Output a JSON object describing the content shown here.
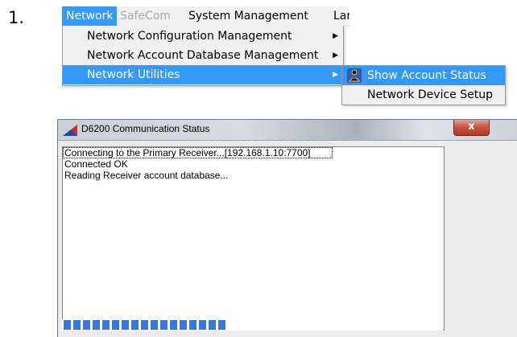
{
  "step": {
    "number": "1."
  },
  "menubar": {
    "items": [
      {
        "label": "Network",
        "state": "active"
      },
      {
        "label": "SafeCom",
        "state": "disabled"
      },
      {
        "label": "System Management",
        "state": "normal"
      },
      {
        "label": "Lang",
        "state": "normal"
      }
    ]
  },
  "dropdown": {
    "items": [
      {
        "label": "Network Configuration Management",
        "has_submenu": true
      },
      {
        "label": "Network Account Database Management",
        "has_submenu": true
      },
      {
        "label": "Network Utilities",
        "has_submenu": true,
        "highlighted": true
      }
    ]
  },
  "submenu": {
    "items": [
      {
        "label": "Show Account Status",
        "icon": "account-status-icon",
        "highlighted": true
      },
      {
        "label": "Network Device Setup"
      }
    ]
  },
  "window": {
    "title": "D6200 Communication Status",
    "close_label": "x",
    "log_lines": [
      "Connecting to the Primary Receiver...[192.168.1.10:7700]",
      "Connected OK",
      "Reading Receiver account database..."
    ],
    "progress_fraction": 0.45,
    "colors": {
      "accent": "#3399ff",
      "progress": "#2f7ae5"
    }
  }
}
